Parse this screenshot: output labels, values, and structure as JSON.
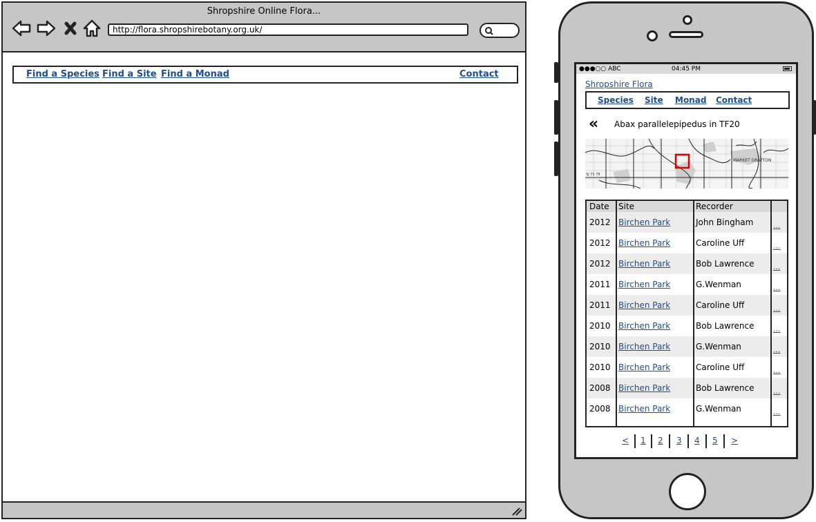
{
  "browser": {
    "title": "Shropshire Online Flora...",
    "url": "http://flora.shropshirebotany.org.uk/",
    "nav": {
      "species": "Find a Species",
      "site": "Find a Site",
      "monad": "Find a Monad",
      "contact": "Contact"
    }
  },
  "phone": {
    "status": {
      "carrier": "●●●○○ ABC",
      "time": "04:45 PM"
    },
    "site_title": "Shropshire Flora",
    "nav": {
      "species": "Species",
      "site": "Site",
      "monad": "Monad",
      "contact": "Contact"
    },
    "back": "«",
    "heading": "Abax parallelepipedus in TF20",
    "map": {
      "place_label": "MARKET DRAYTON",
      "grid_label": "SJ 73 78"
    },
    "table": {
      "headers": {
        "date": "Date",
        "site": "Site",
        "recorder": "Recorder"
      },
      "rows": [
        {
          "date": "2012",
          "site": "Birchen Park",
          "recorder": "John Bingham",
          "more": "..."
        },
        {
          "date": "2012",
          "site": "Birchen Park",
          "recorder": "Caroline Uff",
          "more": "..."
        },
        {
          "date": "2012",
          "site": "Birchen Park",
          "recorder": "Bob Lawrence",
          "more": "..."
        },
        {
          "date": "2011",
          "site": "Birchen Park",
          "recorder": "G.Wenman",
          "more": "..."
        },
        {
          "date": "2011",
          "site": "Birchen Park",
          "recorder": "Caroline Uff",
          "more": "..."
        },
        {
          "date": "2010",
          "site": "Birchen Park",
          "recorder": "Bob Lawrence",
          "more": "..."
        },
        {
          "date": "2010",
          "site": "Birchen Park",
          "recorder": "G.Wenman",
          "more": "..."
        },
        {
          "date": "2010",
          "site": "Birchen Park",
          "recorder": "Caroline Uff",
          "more": "..."
        },
        {
          "date": "2008",
          "site": "Birchen Park",
          "recorder": "Bob Lawrence",
          "more": "..."
        },
        {
          "date": "2008",
          "site": "Birchen Park",
          "recorder": "G.Wenman",
          "more": "..."
        }
      ]
    },
    "pager": {
      "prev": "<",
      "pages": [
        "1",
        "2",
        "3",
        "4",
        "5"
      ],
      "next": ">"
    }
  },
  "colors": {
    "link": "#1f4e8c",
    "chrome": "#c6c6c6",
    "highlight_box": "#e00000"
  },
  "icons": [
    "back-arrow-icon",
    "forward-arrow-icon",
    "stop-icon",
    "home-icon",
    "search-icon",
    "resize-grip-icon",
    "battery-icon"
  ]
}
